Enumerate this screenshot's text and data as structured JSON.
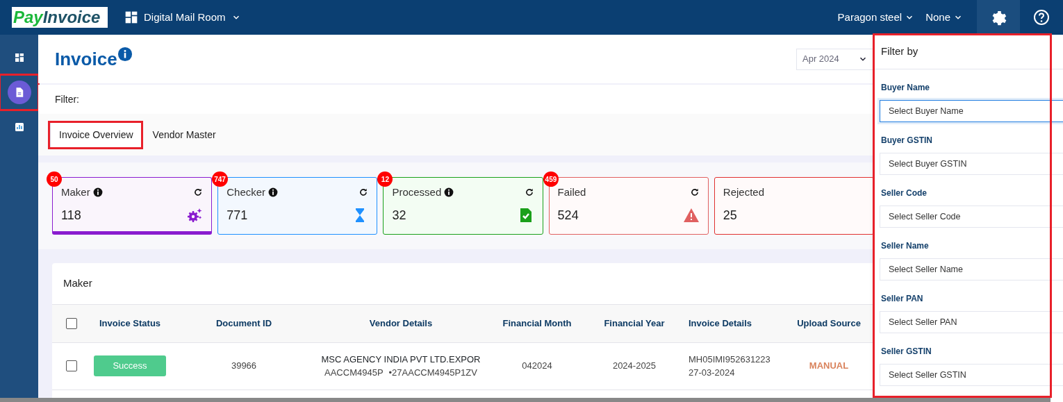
{
  "header": {
    "logo": {
      "part1": "Pay",
      "part2": "Invoice"
    },
    "module": "Digital Mail Room",
    "company": "Paragon steel",
    "branch": "None"
  },
  "sidebar": {
    "items": [
      {
        "kind": "dashboard",
        "selected": false,
        "highlighted": false
      },
      {
        "kind": "document",
        "selected": true,
        "highlighted": true
      },
      {
        "kind": "chart",
        "selected": false,
        "highlighted": false
      }
    ]
  },
  "page": {
    "title": "Invoice",
    "month": "Apr 2024",
    "filter_label": "Filter:"
  },
  "tabs": [
    {
      "label": "Invoice Overview",
      "selected": true,
      "highlighted": true
    },
    {
      "label": "Vendor Master",
      "selected": false,
      "highlighted": false
    }
  ],
  "cards": [
    {
      "kind": "maker",
      "label": "Maker",
      "count": "118",
      "badge": "50",
      "info": true,
      "refresh": true,
      "color": "#8a1ccf",
      "selected": true
    },
    {
      "kind": "checker",
      "label": "Checker",
      "count": "771",
      "badge": "747",
      "info": true,
      "refresh": true,
      "color": "#1e90ff",
      "selected": false
    },
    {
      "kind": "processed",
      "label": "Processed",
      "count": "32",
      "badge": "12",
      "info": true,
      "refresh": true,
      "color": "#1aa01a",
      "selected": false
    },
    {
      "kind": "failed",
      "label": "Failed",
      "count": "524",
      "badge": "459",
      "info": false,
      "refresh": true,
      "color": "#e06060",
      "selected": false
    },
    {
      "kind": "rejected",
      "label": "Rejected",
      "count": "25",
      "info": false,
      "refresh": false,
      "color": "#e03030",
      "selected": false
    }
  ],
  "table": {
    "title": "Maker",
    "select_all": false,
    "columns": [
      "Invoice Status",
      "Document ID",
      "Vendor Details",
      "Financial Month",
      "Financial Year",
      "Invoice Details",
      "Upload Source"
    ],
    "rows": [
      {
        "checked": false,
        "status": "Success",
        "document_id": "39966",
        "vendor_name": "MSC AGENCY INDIA PVT LTD.EXPOR",
        "vendor_pan": "AACCM4945P",
        "vendor_gstin": "•27AACCM4945P1ZV",
        "month": "042024",
        "year": "2024-2025",
        "invoice_no": "MH05IMI952631223",
        "invoice_date": "27-03-2024",
        "source": "MANUAL"
      }
    ]
  },
  "filter_panel": {
    "title": "Filter by",
    "highlighted": true,
    "fields": [
      {
        "label": "Buyer Name",
        "placeholder": "Select Buyer Name",
        "focused": true
      },
      {
        "label": "Buyer GSTIN",
        "placeholder": "Select Buyer GSTIN",
        "focused": false
      },
      {
        "label": "Seller Code",
        "placeholder": "Select Seller Code",
        "focused": false
      },
      {
        "label": "Seller Name",
        "placeholder": "Select Seller Name",
        "focused": false
      },
      {
        "label": "Seller PAN",
        "placeholder": "Select Seller PAN",
        "focused": false
      },
      {
        "label": "Seller GSTIN",
        "placeholder": "Select Seller GSTIN",
        "focused": false
      }
    ]
  }
}
